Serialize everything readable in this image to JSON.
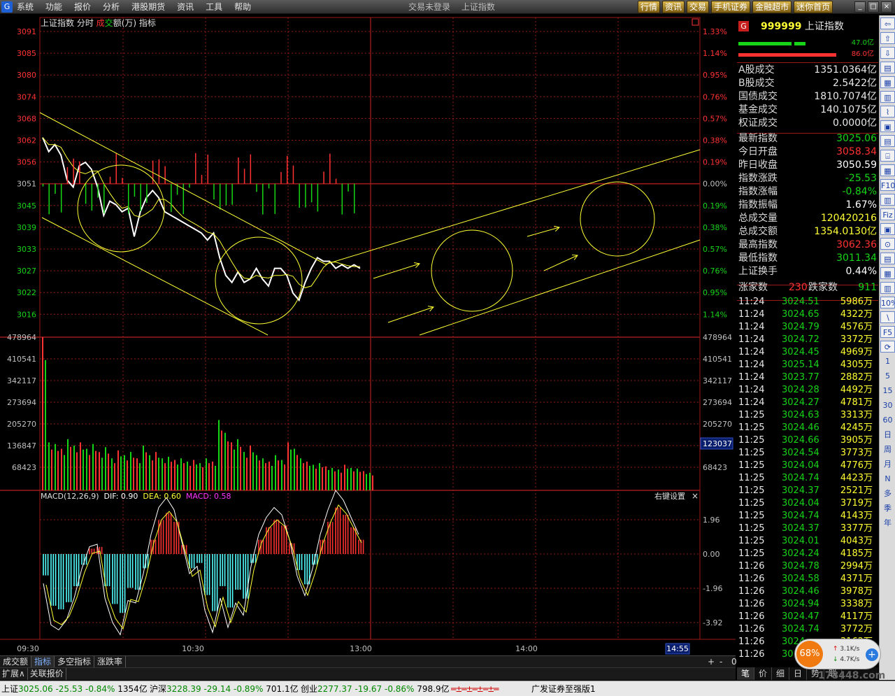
{
  "menubar": {
    "logo": "G",
    "items": [
      "系统",
      "功能",
      "报价",
      "分析",
      "港股期货",
      "资讯",
      "工具",
      "帮助"
    ],
    "status": [
      "交易未登录",
      "上证指数"
    ],
    "right_buttons": [
      "行情",
      "资讯",
      "交易",
      "手机证券",
      "金融超市",
      "迷你首页"
    ],
    "window_buttons": [
      "_",
      "□",
      "×"
    ]
  },
  "chart": {
    "header": {
      "name": "上证指数",
      "mode": "分时",
      "vol_a": "成",
      "vol_b": "交",
      "vol_c": "额(万)",
      "ind": "指标"
    },
    "price_left_ticks": [
      "3091",
      "3085",
      "3080",
      "3074",
      "3068",
      "3062",
      "3056",
      "3051",
      "3045",
      "3039",
      "3033",
      "3027",
      "3022",
      "3016"
    ],
    "price_right_ticks": [
      "1.33%",
      "1.14%",
      "0.95%",
      "0.76%",
      "0.57%",
      "0.38%",
      "0.19%",
      "0.00%",
      "0.19%",
      "0.38%",
      "0.57%",
      "0.76%",
      "0.95%",
      "1.14%"
    ],
    "volume_left_ticks": [
      "478964",
      "410541",
      "342117",
      "273694",
      "205270",
      "136847",
      "68423"
    ],
    "volume_right_ticks": [
      "478964",
      "410541",
      "342117",
      "273694",
      "205270",
      "",
      "68423"
    ],
    "volume_marker": "123037",
    "macd_label": {
      "name": "MACD(12,26,9)",
      "dif": "DIF: 0.90",
      "dea": "DEA: 0.60",
      "macd": "MACD: 0.58"
    },
    "macd_ticks": [
      "1.96",
      "0.00",
      "-1.96",
      "-3.92"
    ],
    "right_settings": "右键设置",
    "close_glyph": "×",
    "time_ticks": [
      "09:30",
      "10:30",
      "13:00",
      "14:00"
    ],
    "time_marker": "14:55",
    "colors": {
      "up": "#ff3232",
      "down": "#16d516",
      "grid": "#9a1a1a",
      "trend": "#ffff33",
      "price": "#ffffff",
      "macd_neg": "#54ffff"
    }
  },
  "chart_data": {
    "type": "line",
    "title": "上证指数",
    "ylim": [
      3011,
      3091
    ],
    "base": 3050.59,
    "series": [
      {
        "name": "上证指数",
        "values": [
          3061,
          3057,
          3059,
          3056,
          3049,
          3047,
          3053,
          3054,
          3052,
          3047,
          3039,
          3043,
          3042,
          3040,
          3041,
          3033,
          3040,
          3044,
          3046,
          3044,
          3040,
          3039,
          3038,
          3037,
          3036,
          3035,
          3034,
          3032,
          3034,
          3027,
          3022,
          3020,
          3023,
          3020,
          3021,
          3024,
          3021,
          3019,
          3024,
          3024,
          3022,
          3017,
          3015,
          3020,
          3024,
          3027,
          3026,
          3026,
          3024,
          3025,
          3024,
          3025,
          3024
        ]
      }
    ],
    "volume": [
      478964,
      150000,
      145000,
      130000,
      160000,
      140000,
      150000,
      130000,
      145000,
      120000,
      135000,
      100000,
      125000,
      110000,
      120000,
      100000,
      140000,
      110000,
      120000,
      100000,
      105000,
      95000,
      100000,
      90000,
      95000,
      85000,
      100000,
      90000,
      220000,
      180000,
      150000,
      160000,
      120000,
      140000,
      110000,
      100000,
      90000,
      110000,
      95000,
      150000,
      130000,
      100000,
      90000,
      80000,
      85000,
      75000,
      70000,
      65000,
      80000,
      70000,
      68000,
      60000,
      55000
    ],
    "macd": {
      "hist": [
        -1.2,
        -2.9,
        -3.1,
        -2.7,
        -1.8,
        -0.6,
        0.3,
        0.4,
        -1.8,
        -2.8,
        -3.3,
        -1.9,
        -2.0,
        -0.8,
        0.8,
        1.9,
        2.3,
        1.8,
        0.5,
        -0.8,
        -0.5,
        -2.3,
        -3.2,
        -1.8,
        -3.0,
        -2.0,
        -2.5,
        -0.5,
        0.8,
        1.5,
        1.9,
        1.6,
        0.6,
        -0.9,
        -1.7,
        -0.6,
        0.8,
        1.8,
        2.6,
        2.2,
        1.5,
        0.8
      ]
    },
    "open": 3058.34,
    "prev_close": 3050.59,
    "high": 3062.36,
    "low": 3011.34
  },
  "rp": {
    "badge": "G",
    "code": "999999",
    "name": "上证指数",
    "amt_up": "47.0亿",
    "amt_down": "86.0亿",
    "summary": [
      {
        "l": "A股成交",
        "v": "1351.0364亿"
      },
      {
        "l": "B股成交",
        "v": "2.5422亿"
      },
      {
        "l": "国债成交",
        "v": "1810.7074亿"
      },
      {
        "l": "基金成交",
        "v": "140.1075亿"
      },
      {
        "l": "权证成交",
        "v": "0.0000亿"
      }
    ],
    "quote": [
      {
        "l": "最新指数",
        "v": "3025.06",
        "c": "#16d516"
      },
      {
        "l": "今日开盘",
        "v": "3058.34",
        "c": "#ff3232"
      },
      {
        "l": "昨日收盘",
        "v": "3050.59",
        "c": "#ffffff"
      },
      {
        "l": "指数涨跌",
        "v": "-25.53",
        "c": "#16d516"
      },
      {
        "l": "指数涨幅",
        "v": "-0.84%",
        "c": "#16d516"
      },
      {
        "l": "指数振幅",
        "v": "1.67%",
        "c": "#ffffff"
      },
      {
        "l": "总成交量",
        "v": "120420216",
        "c": "#ffff33"
      },
      {
        "l": "总成交额",
        "v": "1354.0130亿",
        "c": "#ffff33"
      },
      {
        "l": "最高指数",
        "v": "3062.36",
        "c": "#ff3232"
      },
      {
        "l": "最低指数",
        "v": "3011.34",
        "c": "#16d516"
      },
      {
        "l": "上证换手",
        "v": "0.44%",
        "c": "#ffffff"
      }
    ],
    "breadth": {
      "up_l": "涨家数",
      "up_v": "230",
      "dn_l": "跌家数",
      "dn_v": "911"
    },
    "ticks": [
      [
        "11:24",
        "3024.51",
        "5986万"
      ],
      [
        "11:24",
        "3024.65",
        "4322万"
      ],
      [
        "11:24",
        "3024.79",
        "4576万"
      ],
      [
        "11:24",
        "3024.72",
        "3372万"
      ],
      [
        "11:24",
        "3024.45",
        "4969万"
      ],
      [
        "11:24",
        "3025.14",
        "4305万"
      ],
      [
        "11:24",
        "3023.77",
        "2882万"
      ],
      [
        "11:24",
        "3024.28",
        "4492万"
      ],
      [
        "11:24",
        "3024.27",
        "4781万"
      ],
      [
        "11:25",
        "3024.63",
        "3313万"
      ],
      [
        "11:25",
        "3024.46",
        "4245万"
      ],
      [
        "11:25",
        "3024.66",
        "3905万"
      ],
      [
        "11:25",
        "3024.54",
        "3773万"
      ],
      [
        "11:25",
        "3024.04",
        "4776万"
      ],
      [
        "11:25",
        "3024.74",
        "4423万"
      ],
      [
        "11:25",
        "3024.37",
        "2521万"
      ],
      [
        "11:25",
        "3024.04",
        "3719万"
      ],
      [
        "11:25",
        "3024.74",
        "4143万"
      ],
      [
        "11:25",
        "3024.37",
        "3377万"
      ],
      [
        "11:25",
        "3024.01",
        "4043万"
      ],
      [
        "11:25",
        "3024.24",
        "4185万"
      ],
      [
        "11:26",
        "3024.78",
        "2994万"
      ],
      [
        "11:26",
        "3024.58",
        "4371万"
      ],
      [
        "11:26",
        "3024.46",
        "3978万"
      ],
      [
        "11:26",
        "3024.94",
        "3338万"
      ],
      [
        "11:26",
        "3024.47",
        "4117万"
      ],
      [
        "11:26",
        "3024.74",
        "3772万"
      ],
      [
        "11:26",
        "3024.",
        "3162万"
      ],
      [
        "11:26",
        "30",
        "3076万"
      ]
    ],
    "tabs": [
      "笔",
      "价",
      "细",
      "日",
      "势",
      "联"
    ]
  },
  "vbar": [
    "⇦",
    "⇧",
    "⇩",
    "▤",
    "▦",
    "▥",
    "⌇",
    "▣",
    "▤",
    "⌸",
    "▦",
    "F10",
    "▥",
    "Fiz",
    "▣",
    "⊙",
    "▤",
    "▦",
    "▥",
    "10%",
    "∖",
    "F5",
    "⟳",
    "1",
    "5",
    "15",
    "30",
    "60",
    "日",
    "周",
    "月",
    "N",
    "多",
    "季",
    "年"
  ],
  "btabs": [
    "成交额",
    "指标",
    "多空指标",
    "涨跌率"
  ],
  "btabs_active": 1,
  "btabs_ctl": [
    "+",
    "-",
    "0"
  ],
  "btabs2": [
    "扩展∧",
    "关联报价"
  ],
  "statusbar": {
    "sh_l": "上证",
    "sh_v": "3025.06",
    "sh_d": "-25.53",
    "sh_p": "-0.84%",
    "sh_a": "1354亿",
    "hs_l": "沪深",
    "hs_v": "3228.39",
    "hs_d": "-29.14",
    "hs_p": "-0.89%",
    "hs_a": "701.1亿",
    "cy_l": "创业",
    "cy_v": "2277.37",
    "cy_d": "-19.67",
    "cy_p": "-0.86%",
    "cy_a": "798.9亿",
    "broker": "广发证券至强版1"
  },
  "netw": {
    "pct": "68%",
    "up": "3.1K/s",
    "down": "4.7K/s",
    "plus": "+"
  },
  "watermark": "178448.com"
}
